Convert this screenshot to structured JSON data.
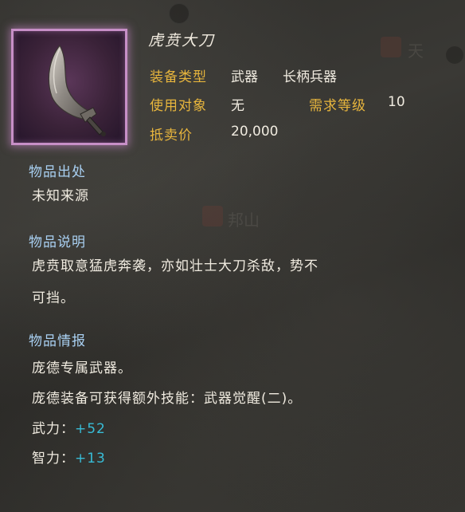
{
  "item": {
    "name": "虎贲大刀",
    "equip_type_label": "装备类型",
    "equip_type_value": "武器",
    "equip_subtype_value": "长柄兵器",
    "user_label": "使用对象",
    "user_value": "无",
    "level_label": "需求等级",
    "level_value": "10",
    "price_label": "抵卖价",
    "price_value": "20,000",
    "icon": "curved-blade-icon",
    "frame_color": "#c78fc7"
  },
  "sections": {
    "source_title": "物品出处",
    "source_text": "未知来源",
    "desc_title": "物品说明",
    "desc_line1": "虎贲取意猛虎奔袭，亦如壮士大刀杀敌，势不",
    "desc_line2": "可挡。",
    "info_title": "物品情报",
    "info_line1": "庞德专属武器。",
    "info_line2": "庞德装备可获得额外技能：武器觉醒(二)。"
  },
  "stats": [
    {
      "label": "武力：",
      "value": "+52"
    },
    {
      "label": "智力：",
      "value": "+13"
    }
  ],
  "background": {
    "watermark_1": "天",
    "watermark_2": "邦山"
  },
  "colors": {
    "gold_label": "#e7b53d",
    "blue_label": "#a9d0f2",
    "stat_cyan": "#38bcd6",
    "text": "#f0ebe0"
  }
}
